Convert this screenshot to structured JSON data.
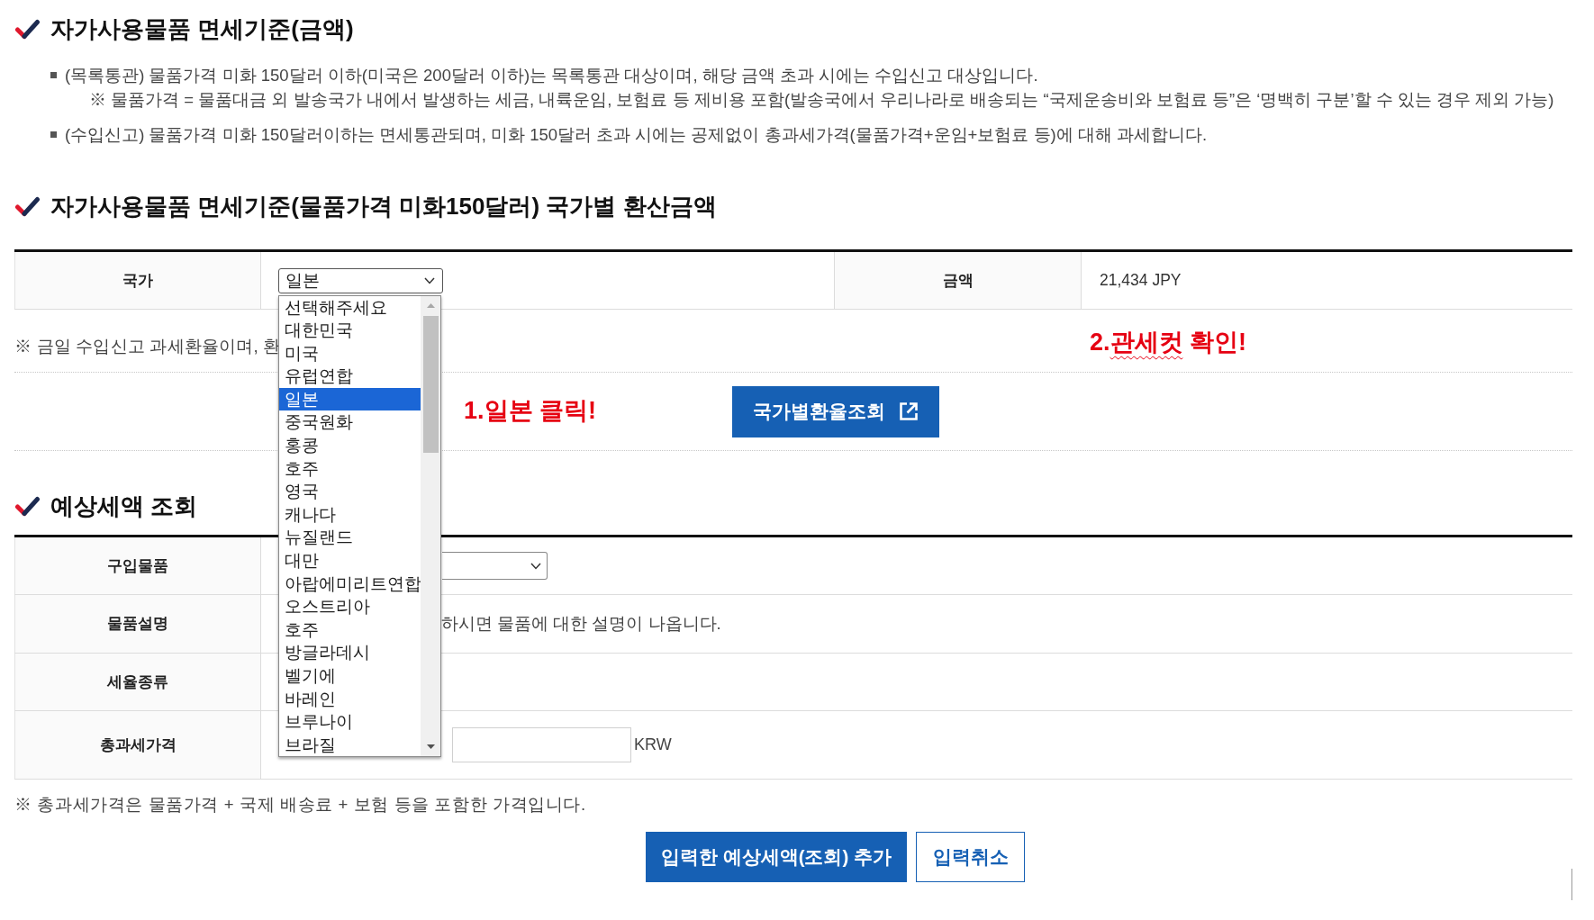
{
  "duty_free_basis": {
    "title": "자가사용물품 면세기준(금액)",
    "bullets": [
      {
        "text": "(목록통관) 물품가격 미화 150달러 이하(미국은 200달러 이하)는 목록통관 대상이며, 해당 금액 초과 시에는 수입신고 대상입니다.",
        "note": "※ 물품가격 = 물품대금 외 발송국가 내에서 발생하는 세금, 내륙운임, 보험료 등 제비용 포함(발송국에서 우리나라로 배송되는 “국제운송비와 보험료 등”은 ‘명백히 구분’할 수 있는 경우 제외 가능)"
      },
      {
        "text": "(수입신고) 물품가격 미화 150달러이하는 면세통관되며, 미화 150달러 초과 시에는 공제없이 총과세가격(물품가격+운임+보험료 등)에 대해 과세합니다."
      }
    ]
  },
  "conversion": {
    "title": "자가사용물품 면세기준(물품가격 미화150달러) 국가별 환산금액",
    "country_label": "국가",
    "country_select": {
      "value": "일본",
      "expanded": true,
      "options": [
        {
          "label": "선택해주세요",
          "selected": false
        },
        {
          "label": "대한민국",
          "selected": false
        },
        {
          "label": "미국",
          "selected": false
        },
        {
          "label": "유럽연합",
          "selected": false
        },
        {
          "label": "일본",
          "selected": true
        },
        {
          "label": "중국원화",
          "selected": false
        },
        {
          "label": "홍콩",
          "selected": false
        },
        {
          "label": "호주",
          "selected": false
        },
        {
          "label": "영국",
          "selected": false
        },
        {
          "label": "캐나다",
          "selected": false
        },
        {
          "label": "뉴질랜드",
          "selected": false
        },
        {
          "label": "대만",
          "selected": false
        },
        {
          "label": "아랍에미리트연합",
          "selected": false
        },
        {
          "label": "오스트리아",
          "selected": false
        },
        {
          "label": "호주",
          "selected": false
        },
        {
          "label": "방글라데시",
          "selected": false
        },
        {
          "label": "벨기에",
          "selected": false
        },
        {
          "label": "바레인",
          "selected": false
        },
        {
          "label": "브루나이",
          "selected": false
        },
        {
          "label": "브라질",
          "selected": false
        }
      ]
    },
    "amount_label": "금액",
    "amount_value": "21,434 JPY",
    "note_row": {
      "text": "※ 금일 수입신고 과세환율이며, 환",
      "annotation": [
        {
          "text": "2.",
          "spellcheck_underline": false
        },
        {
          "text": "관세컷",
          "spellcheck_underline": true
        },
        {
          "text": " 확인!",
          "spellcheck_underline": false
        }
      ]
    },
    "button_row": {
      "annotation": [
        {
          "text": "1.일본 클릭!",
          "spellcheck_underline": false
        }
      ],
      "button": "국가별환율조회"
    }
  },
  "estimate": {
    "title": "예상세액 조회",
    "rows": [
      {
        "kind": "select",
        "label": "구입물품"
      },
      {
        "kind": "text",
        "label": "물품설명",
        "value": "하시면 물품에 대한 설명이 나옵니다."
      },
      {
        "kind": "empty",
        "label": "세율종류"
      },
      {
        "kind": "amount",
        "label": "총과세가격",
        "unit": "KRW"
      }
    ],
    "footnote": "※ 총과세가격은 물품가격 + 국제 배송료 + 보험 등을 포함한 가격입니다.",
    "buttons": [
      {
        "kind": "primary",
        "label": "입력한 예상세액(조회) 추가"
      },
      {
        "kind": "outline",
        "label": "입력취소"
      }
    ]
  }
}
